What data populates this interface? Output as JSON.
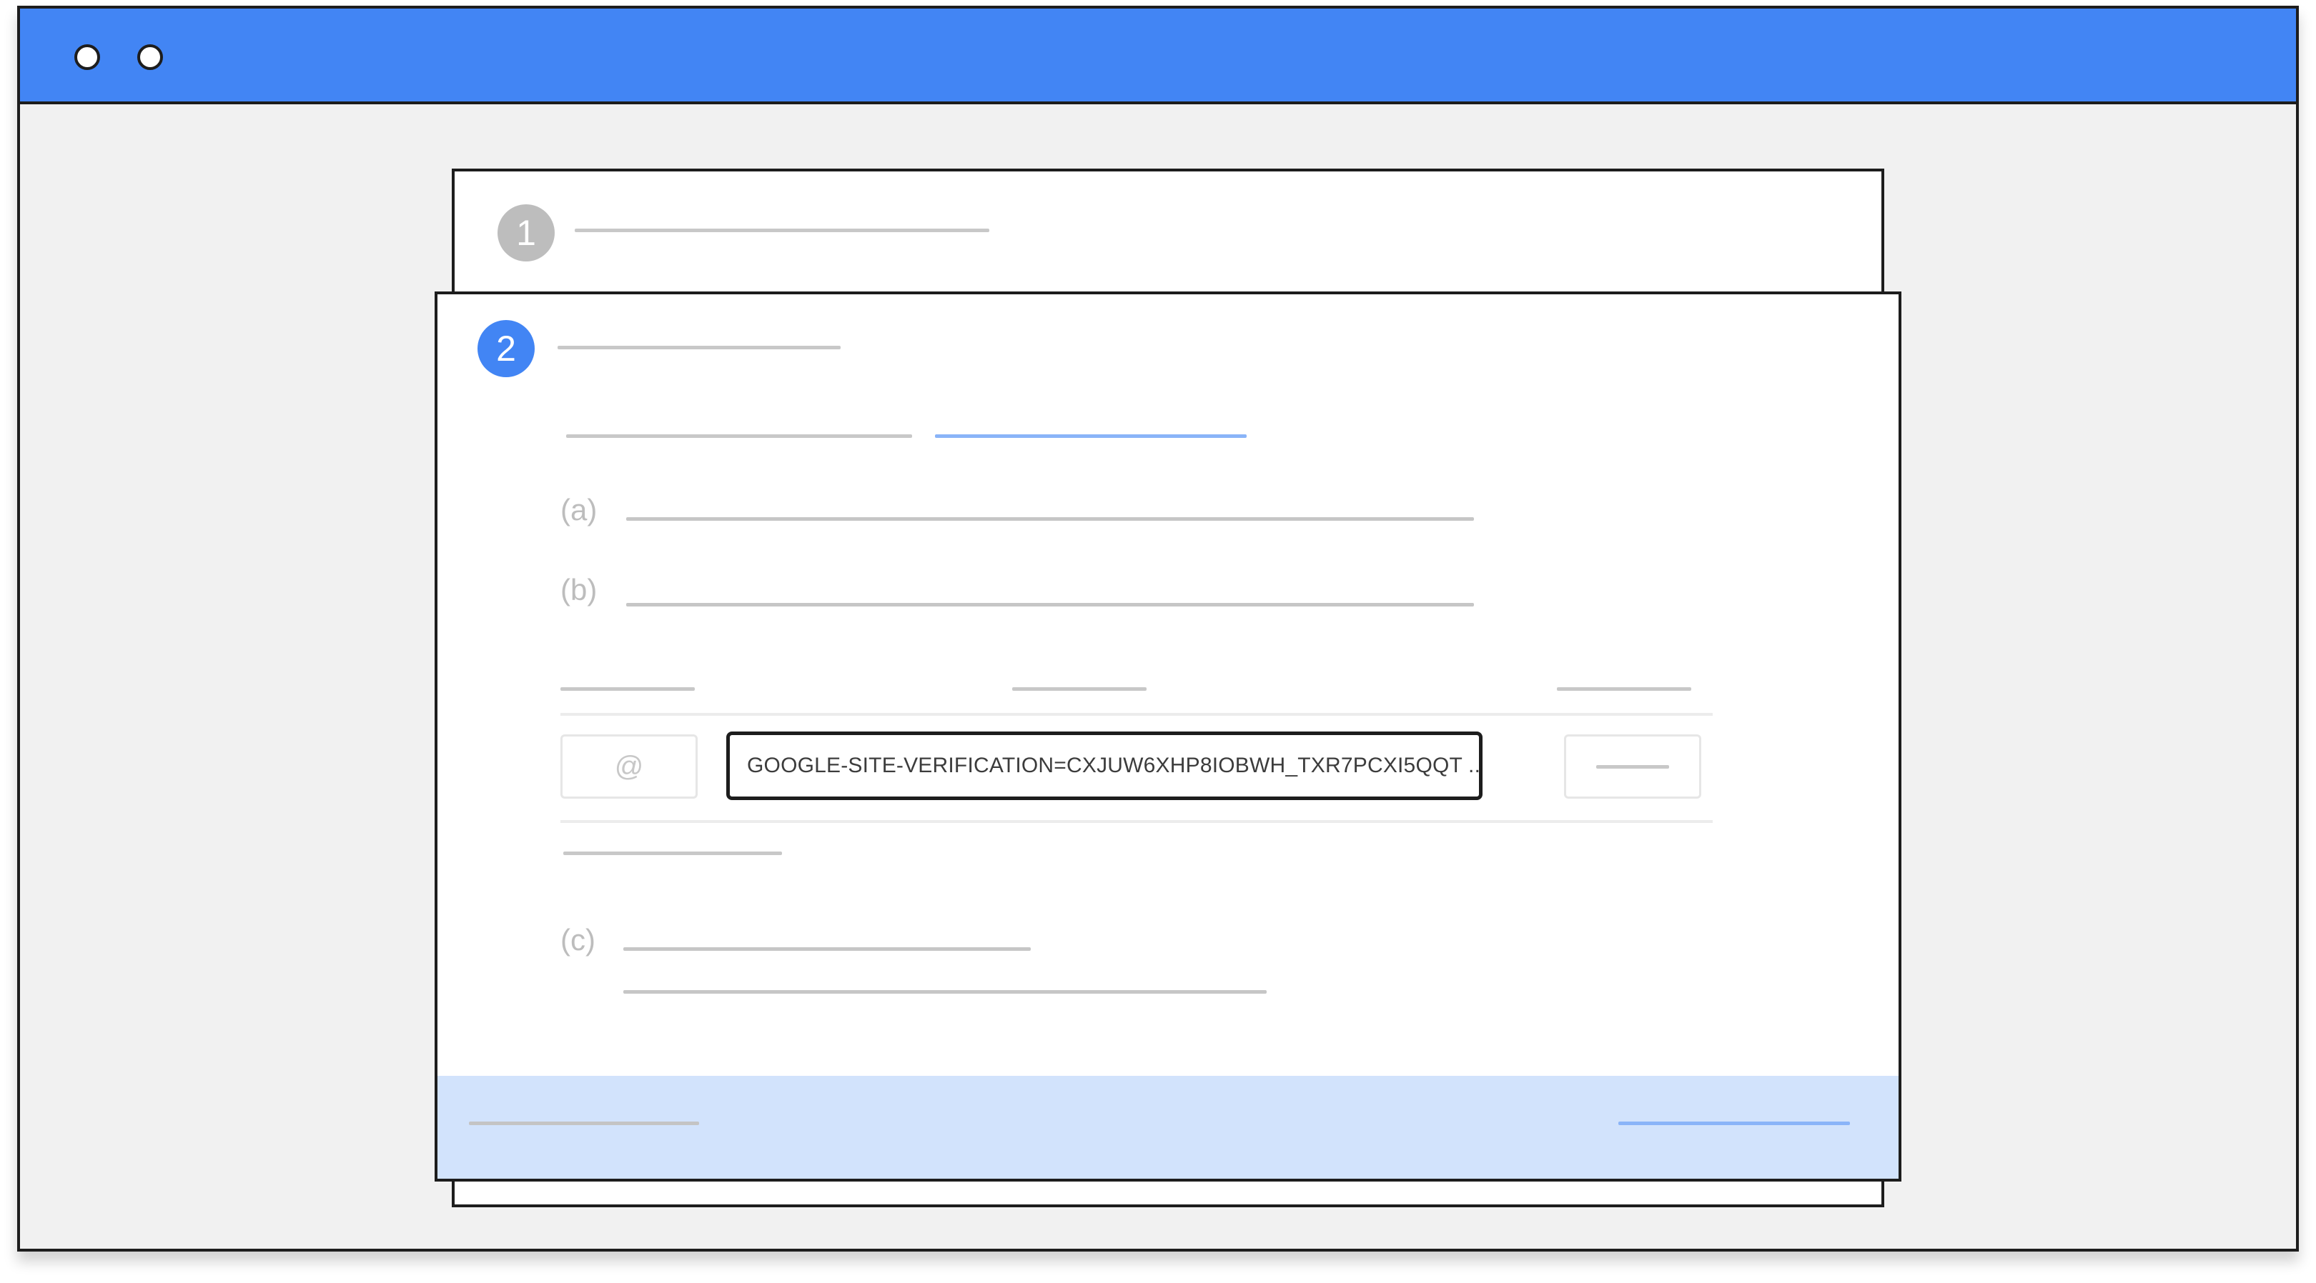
{
  "window": {
    "titlebar_color": "#4285f4",
    "controls": [
      "window-dot",
      "window-dot"
    ]
  },
  "steps": [
    {
      "number": "1",
      "state": "completed",
      "color": "#bdbdbd"
    },
    {
      "number": "2",
      "state": "active",
      "color": "#4285f4"
    }
  ],
  "instructions": {
    "item_a": "(a)",
    "item_b": "(b)",
    "item_c": "(c)"
  },
  "dns_record": {
    "host_placeholder": "@",
    "value": "GOOGLE-SITE-VERIFICATION=CXJUW6XHP8IOBWH_TXR7PCXI5QQT ..."
  },
  "footer": {
    "color": "#d2e3fc"
  }
}
